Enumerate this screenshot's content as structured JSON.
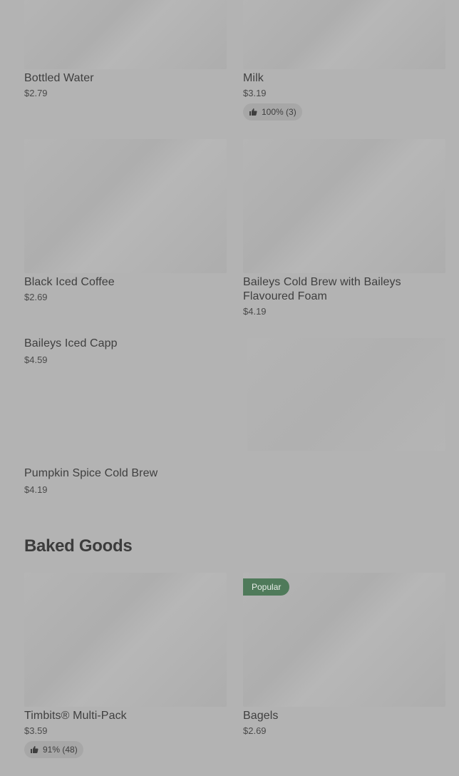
{
  "drinks": [
    {
      "name": "Bottled Water",
      "price": "$2.79"
    },
    {
      "name": "Milk",
      "price": "$3.19",
      "rating": "100% (3)"
    },
    {
      "name": "Black Iced Coffee",
      "price": "$2.69"
    },
    {
      "name": "Baileys Cold Brew with Baileys Flavoured Foam",
      "price": "$4.19"
    },
    {
      "name": "Baileys Iced Capp",
      "price": "$4.59"
    },
    {
      "name": "Pumpkin Spice Cold Brew",
      "price": "$4.19"
    }
  ],
  "baked_goods": {
    "title": "Baked Goods",
    "items": [
      {
        "name": "Timbits® Multi-Pack",
        "price": "$3.59",
        "rating": "91% (48)"
      },
      {
        "name": "Bagels",
        "price": "$2.69",
        "badge": "Popular"
      }
    ]
  },
  "icons": {
    "rating": "thumbs-up-icon"
  }
}
